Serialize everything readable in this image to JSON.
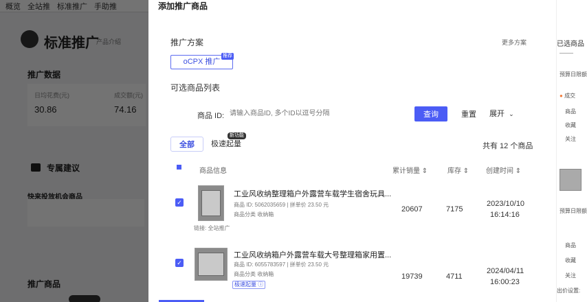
{
  "background": {
    "tabs": [
      "概览",
      "全站推",
      "标准推广",
      "手助推"
    ],
    "title": "标准推广",
    "title_sub": "产品介绍",
    "section_data": "推广数据",
    "metric1_label": "日均花费(元)",
    "metric1_value": "30.86",
    "metric2_label": "成交额(元)",
    "metric2_value": "74.16",
    "section_suggest": "专属建议",
    "suggest_item": "快来投放机会商品",
    "section_products": "推广商品"
  },
  "drawer": {
    "title": "添加推广商品",
    "plan_label": "推广方案",
    "more_link": "更多方案",
    "plan_button": "oCPX 推广",
    "plan_badge": "推荐",
    "list_label": "可选商品列表",
    "filter": {
      "label": "商品 ID:",
      "placeholder": "请输入商品ID, 多个ID以逗号分隔"
    },
    "query_button": "查询",
    "reset_button": "重置",
    "expand_button": "展开",
    "tabs": [
      {
        "label": "全部"
      },
      {
        "label": "极速起量"
      }
    ],
    "tab_badge": "新功能",
    "total": "共有 12 个商品",
    "columns": {
      "info": "商品信息",
      "sales": "累计销量",
      "stock": "库存",
      "created": "创建时间"
    },
    "rows": [
      {
        "name": "工业风收纳整理箱户外露营车载学生宿舍玩具...",
        "meta1": "商品 ID: 5062035659 | 拼单价 23.50 元",
        "meta2": "商品分类  收纳箱",
        "extra": "链接: 全站推广",
        "sales": "20607",
        "stock": "7175",
        "date": "2023/10/10",
        "time": "16:14:16"
      },
      {
        "name": "工业风收纳箱户外露营车载大号整理箱家用置...",
        "meta1": "商品 ID: 6055783597 | 拼单价 23.50 元",
        "meta2": "商品分类  收纳箱",
        "tag": "极速起量",
        "sales": "19739",
        "stock": "4711",
        "date": "2024/04/11",
        "time": "16:00:23"
      }
    ]
  },
  "right_panel": {
    "title": "已选商品",
    "daily": "预算日限额",
    "deal": "成交",
    "items": [
      "商品",
      "收藏",
      "关注"
    ],
    "setting": "出价设置:"
  },
  "colors": {
    "primary": "#4b5cf5",
    "overlay": "#6f7075"
  }
}
